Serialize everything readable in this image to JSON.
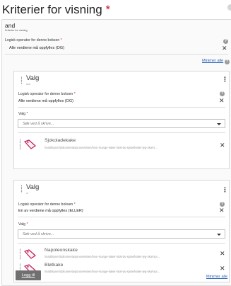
{
  "page": {
    "title": "Kriterier for visning",
    "required_mark": "*"
  },
  "root": {
    "name": "and",
    "subtitle": "Kriterier for visning",
    "operator_label": "Logisk operator for denne boksen",
    "operator_required": "*",
    "operator_value": "Alle verdiene må oppfylles (OG)",
    "minimize_all": "Minimer alle",
    "add_label": "Legg til"
  },
  "cards": [
    {
      "title": "Valg",
      "subtitle": "and",
      "operator_label": "Logisk operator for denne boksen",
      "operator_required": "*",
      "operator_value": "Alle verdiene må oppfylles (OG)",
      "valg_label": "Valg",
      "valg_required": "*",
      "search_placeholder": "Søk ved å skrive...",
      "items": [
        {
          "title": "Sjokoladekake",
          "path": "/mattilsynet/dokumentasjonsveivisen/hvor-mange-kaker-skal-du-spise/kaker-jeg-skal-s..."
        }
      ]
    },
    {
      "title": "Valg",
      "subtitle": "or",
      "operator_label": "Logisk operator for denne boksen",
      "operator_required": "*",
      "operator_value": "En av verdiene må oppfylles (ELLER)",
      "valg_label": "Valg",
      "valg_required": "*",
      "search_placeholder": "Søk ved å skrive...",
      "items": [
        {
          "title": "Napoleonskake",
          "path": "/mattilsynet/dokumentasjonsveivisen/hvor-mange-kaker-skal-du-spise/kaker-jeg-skal-spi..."
        },
        {
          "title": "Bløtkake",
          "path": "/mattilsynet/dokumentasjonsveivisen/hvor-mange-kaker-skal-du-spise/kaker-jeg-skal-spi..."
        }
      ]
    }
  ],
  "icons": {
    "help": "?",
    "close": "✕",
    "kebab": "⋮"
  },
  "colors": {
    "required": "#c41b2e",
    "link": "#2a63b8",
    "tag_icon": "#c2185b",
    "button": "#707070"
  }
}
